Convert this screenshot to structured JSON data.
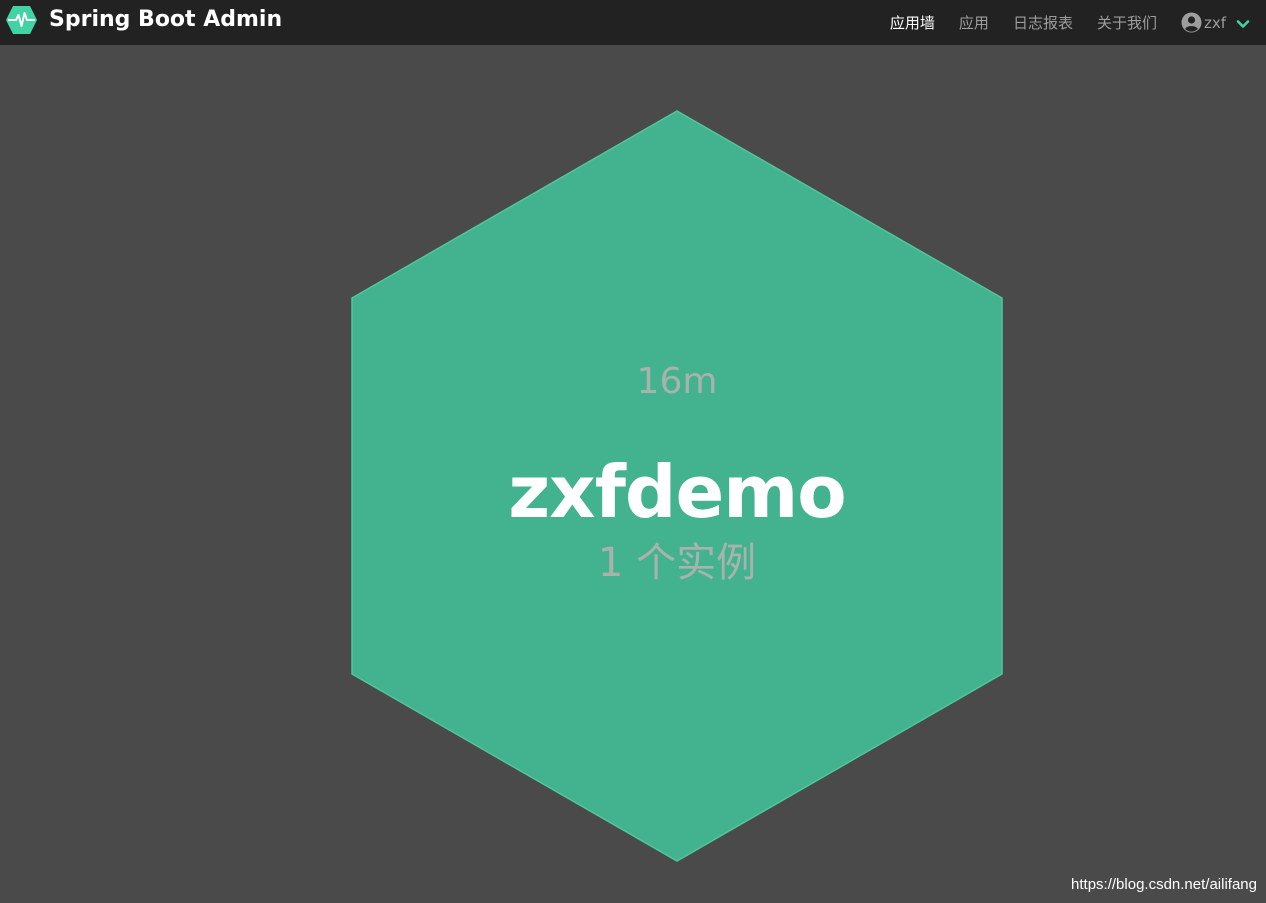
{
  "header": {
    "app_title": "Spring Boot Admin",
    "logo_icon": "pulse-hexagon-icon",
    "nav_items": [
      {
        "label": "应用墙",
        "active": true
      },
      {
        "label": "应用",
        "active": false
      },
      {
        "label": "日志报表",
        "active": false
      },
      {
        "label": "关于我们",
        "active": false
      }
    ],
    "user": {
      "icon": "user-circle-icon",
      "name": "zxf",
      "dropdown_icon": "chevron-down-icon"
    }
  },
  "wallboard": {
    "application": {
      "uptime": "16m",
      "name": "zxfdemo",
      "instances": "1 个实例",
      "status_color": "#42b38e"
    }
  },
  "watermark": "https://blog.csdn.net/ailifang",
  "colors": {
    "navbar_bg": "#222222",
    "page_bg": "#4a4a4a",
    "accent": "#42d3a5",
    "hex_fill": "#42b38e"
  }
}
